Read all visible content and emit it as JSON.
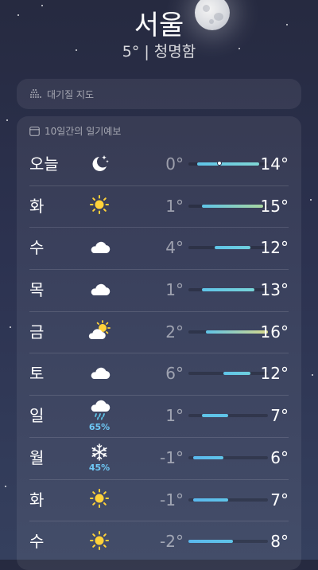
{
  "header": {
    "city": "서울",
    "subtitle": "5° | 청명함"
  },
  "air_quality": {
    "label": "대기질 지도",
    "icon": "dots-map-icon"
  },
  "forecast": {
    "title": "10일간의 일기예보",
    "icon": "calendar-icon",
    "temp_scale": {
      "min": -2,
      "max": 16
    },
    "days": [
      {
        "day": "오늘",
        "icon": "moon-stars-icon",
        "precip": "",
        "low_label": "0°",
        "high_label": "14°",
        "low": 0,
        "high": 14,
        "current": 5,
        "colors": [
          "#5fc4e8",
          "#7fd6d4"
        ]
      },
      {
        "day": "화",
        "icon": "sun-icon",
        "precip": "",
        "low_label": "1°",
        "high_label": "15°",
        "low": 1,
        "high": 15,
        "colors": [
          "#5fc4e8",
          "#a8d6a0"
        ]
      },
      {
        "day": "수",
        "icon": "cloud-icon",
        "precip": "",
        "low_label": "4°",
        "high_label": "12°",
        "low": 4,
        "high": 12,
        "colors": [
          "#5fc4e8",
          "#6fd0de"
        ]
      },
      {
        "day": "목",
        "icon": "cloud-icon",
        "precip": "",
        "low_label": "1°",
        "high_label": "13°",
        "low": 1,
        "high": 13,
        "colors": [
          "#5fc4e8",
          "#78d4d8"
        ]
      },
      {
        "day": "금",
        "icon": "sun-behind-cloud-icon",
        "precip": "",
        "low_label": "2°",
        "high_label": "16°",
        "low": 2,
        "high": 16,
        "colors": [
          "#5fc4e8",
          "#d6d88a"
        ]
      },
      {
        "day": "토",
        "icon": "cloud-icon",
        "precip": "",
        "low_label": "6°",
        "high_label": "12°",
        "low": 6,
        "high": 12,
        "colors": [
          "#5fc4e8",
          "#6fd0de"
        ]
      },
      {
        "day": "일",
        "icon": "cloud-rain-icon",
        "precip": "65%",
        "low_label": "1°",
        "high_label": "7°",
        "low": 1,
        "high": 7,
        "colors": [
          "#5fc4e8",
          "#5fc4e8"
        ]
      },
      {
        "day": "월",
        "icon": "snowflake-icon",
        "precip": "45%",
        "low_label": "-1°",
        "high_label": "6°",
        "low": -1,
        "high": 6,
        "colors": [
          "#5ab8ee",
          "#5fc4e8"
        ]
      },
      {
        "day": "화",
        "icon": "sun-icon",
        "precip": "",
        "low_label": "-1°",
        "high_label": "7°",
        "low": -1,
        "high": 7,
        "colors": [
          "#5ab8ee",
          "#5fc4e8"
        ]
      },
      {
        "day": "수",
        "icon": "sun-icon",
        "precip": "",
        "low_label": "-2°",
        "high_label": "8°",
        "low": -2,
        "high": 8,
        "colors": [
          "#5ab8ee",
          "#5fc4e8"
        ]
      }
    ]
  }
}
